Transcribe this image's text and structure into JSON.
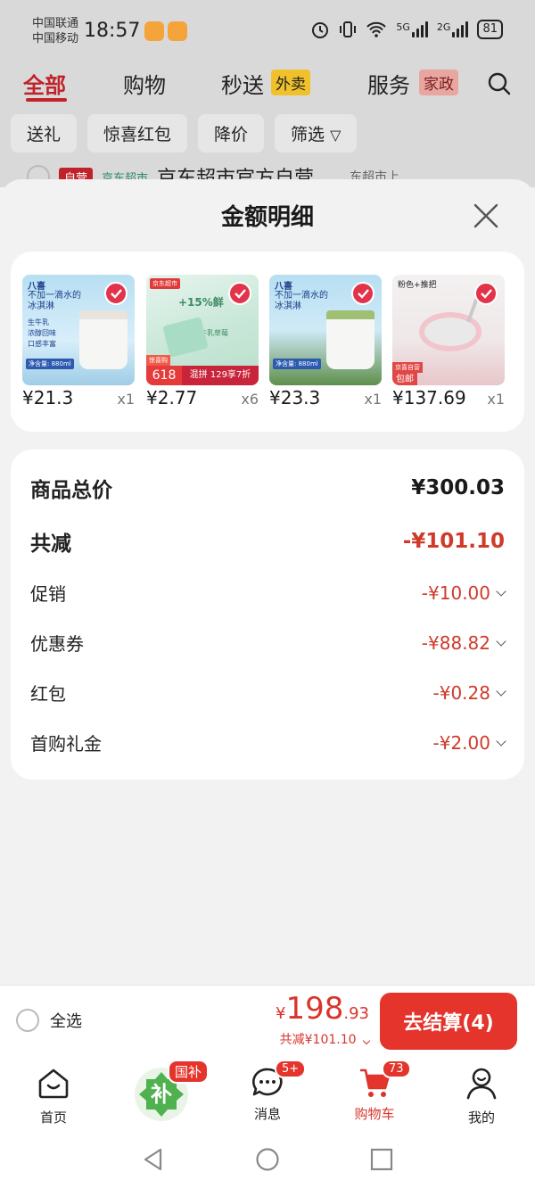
{
  "status_bar": {
    "carrier_1": "中国联通",
    "carrier_2": "中国移动",
    "time": "18:57",
    "net_1": "5G",
    "net_2": "2G",
    "battery": "81"
  },
  "background_app": {
    "tabs": [
      "全部",
      "购物",
      "秒送",
      "服务"
    ],
    "tab_tag_waimai": "外卖",
    "tab_tag_jiazheng": "家政",
    "filters": [
      "送礼",
      "惊喜红包",
      "降价",
      "筛选"
    ],
    "store_tag": "自营",
    "store_tag_2": "京东超市",
    "store_name": "京东超市官方自营",
    "store_hint": "东超市上"
  },
  "sheet": {
    "title": "金额明细",
    "products": [
      {
        "price": "¥21.3",
        "qty": "x1"
      },
      {
        "price": "¥2.77",
        "qty": "x6"
      },
      {
        "price": "¥23.3",
        "qty": "x1"
      },
      {
        "price": "¥137.69",
        "qty": "x1"
      }
    ],
    "product_text": {
      "p1_brand": "八喜",
      "p1_caption": "不加一滴水的冰淇淋",
      "p1_lines": [
        "生牛乳",
        "浓醇回味",
        "口感丰富"
      ],
      "p1_net": "净含量: 880ml",
      "p2_top": "+15%鲜",
      "p2_sub": "好牛乳草莓",
      "p2_tag_1": "京东超市",
      "p2_618": "618",
      "p2_promo": "混拼 129享7折",
      "p2_label": "惊喜购",
      "p3_brand": "八喜",
      "p3_caption": "不加一滴水的冰淇淋",
      "p3_net": "净含量: 880ml",
      "p4_top": "粉色+推把",
      "p4_tag": "京喜自营",
      "p4_tag2": "包邮"
    },
    "summary": {
      "total_label": "商品总价",
      "total_value": "¥300.03",
      "discount_label": "共减",
      "discount_value": "-¥101.10",
      "items": [
        {
          "label": "促销",
          "value": "-¥10.00"
        },
        {
          "label": "优惠券",
          "value": "-¥88.82"
        },
        {
          "label": "红包",
          "value": "-¥0.28"
        },
        {
          "label": "首购礼金",
          "value": "-¥2.00"
        }
      ]
    }
  },
  "checkout": {
    "select_all": "全选",
    "currency": "¥",
    "price_main": "198",
    "price_decimal": ".93",
    "saved": "共减¥101.10",
    "button": "去结算(4)"
  },
  "bottom_nav": {
    "items": [
      {
        "label": "首页"
      },
      {
        "label": "消息",
        "badge": "5+"
      },
      {
        "label": "购物车",
        "badge": "73"
      },
      {
        "label": "我的"
      }
    ],
    "subsidy_char": "补",
    "subsidy_badge": "国补"
  },
  "colors": {
    "accent_red": "#e4342b",
    "price_red": "#d03a2a",
    "check_red": "#e2334a"
  }
}
